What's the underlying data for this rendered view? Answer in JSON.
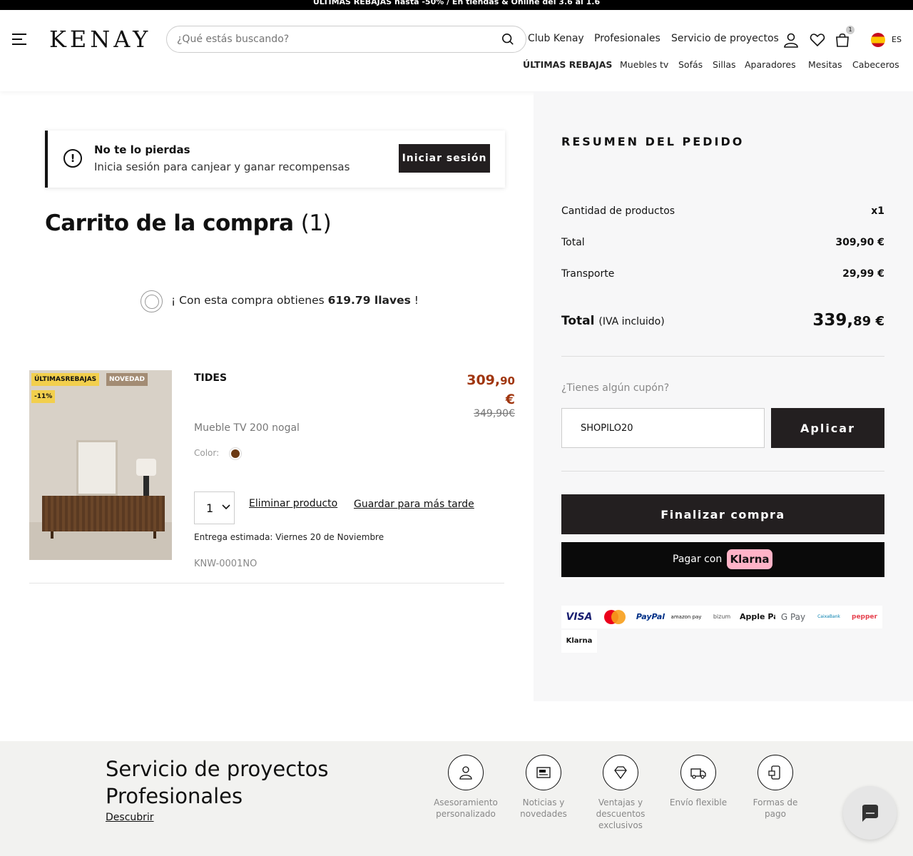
{
  "promo_bar": {
    "text": "ÚLTIMAS REBAJAS hasta -50% / En tiendas & Online del 3.6 al 1.6"
  },
  "header": {
    "logo": "KENAY",
    "search_placeholder": "¿Qué estás buscando?",
    "top_links": [
      "Club Kenay",
      "Profesionales",
      "Servicio de proyectos"
    ],
    "cart_count": "1",
    "language": "ES",
    "categories": [
      "ÚLTIMAS REBAJAS",
      "Muebles tv",
      "Sofás",
      "Sillas",
      "Aparadores",
      "Mesitas",
      "Cabeceros"
    ]
  },
  "login_banner": {
    "title": "No te lo pierdas",
    "subtitle": "Inicia sesión para canjear y ganar recompensas",
    "button": "Iniciar sesión"
  },
  "cart": {
    "title": "Carrito de la compra",
    "count": "(1)",
    "keys_prefix": "¡ Con esta compra obtienes",
    "keys_amount": "619.79 llaves",
    "keys_suffix": "!"
  },
  "product": {
    "badges": [
      "ÚLTIMASREBAJAS",
      "NOVEDAD",
      "-11%"
    ],
    "name": "TIDES",
    "price_int": "309,",
    "price_dec": "90",
    "price_currency": "€",
    "old_price": "349,90€",
    "description": "Mueble TV 200 nogal",
    "color_label": "Color:",
    "color_hex": "#6b3a14",
    "quantity": "1",
    "remove_link": "Eliminar producto",
    "save_link": "Guardar para más tarde",
    "delivery": "Entrega estimada: Viernes 20 de Noviembre",
    "sku": "KNW-0001NO"
  },
  "summary": {
    "title": "RESUMEN DEL PEDIDO",
    "rows": [
      {
        "label": "Cantidad de productos",
        "value": "x1"
      },
      {
        "label": "Total",
        "value": "309,90 €"
      },
      {
        "label": "Transporte",
        "value": "29,99 €"
      }
    ],
    "grand_label": "Total",
    "grand_note": "(IVA incluido)",
    "grand_int": "339,",
    "grand_dec": "89 €",
    "coupon_label": "¿Tienes algún cupón?",
    "coupon_value": "SHOPILO20",
    "apply_button": "Aplicar",
    "checkout_button": "Finalizar compra",
    "klarna_prefix": "Pagar con",
    "klarna_brand": "Klarna",
    "payment_methods": [
      "VISA",
      "Mastercard",
      "PayPal",
      "amazon pay",
      "bizum",
      "Apple Pay",
      "G Pay",
      "CaixaBank",
      "pepper",
      "Klarna"
    ]
  },
  "footer": {
    "title_line1": "Servicio de proyectos",
    "title_line2": "Profesionales",
    "link": "Descubrir",
    "features": [
      {
        "line1": "Asesoramiento",
        "line2": "personalizado",
        "line3": ""
      },
      {
        "line1": "Noticias y",
        "line2": "novedades",
        "line3": ""
      },
      {
        "line1": "Ventajas y",
        "line2": "descuentos",
        "line3": "exclusivos"
      },
      {
        "line1": "Envío flexible",
        "line2": "",
        "line3": ""
      },
      {
        "line1": "Formas de",
        "line2": "pago",
        "line3": ""
      }
    ]
  },
  "colors": {
    "dark_button": "#231f20",
    "price_red": "#a0360f",
    "summary_bg": "#f7f7f8",
    "klarna_pink": "#ffb3c7"
  }
}
